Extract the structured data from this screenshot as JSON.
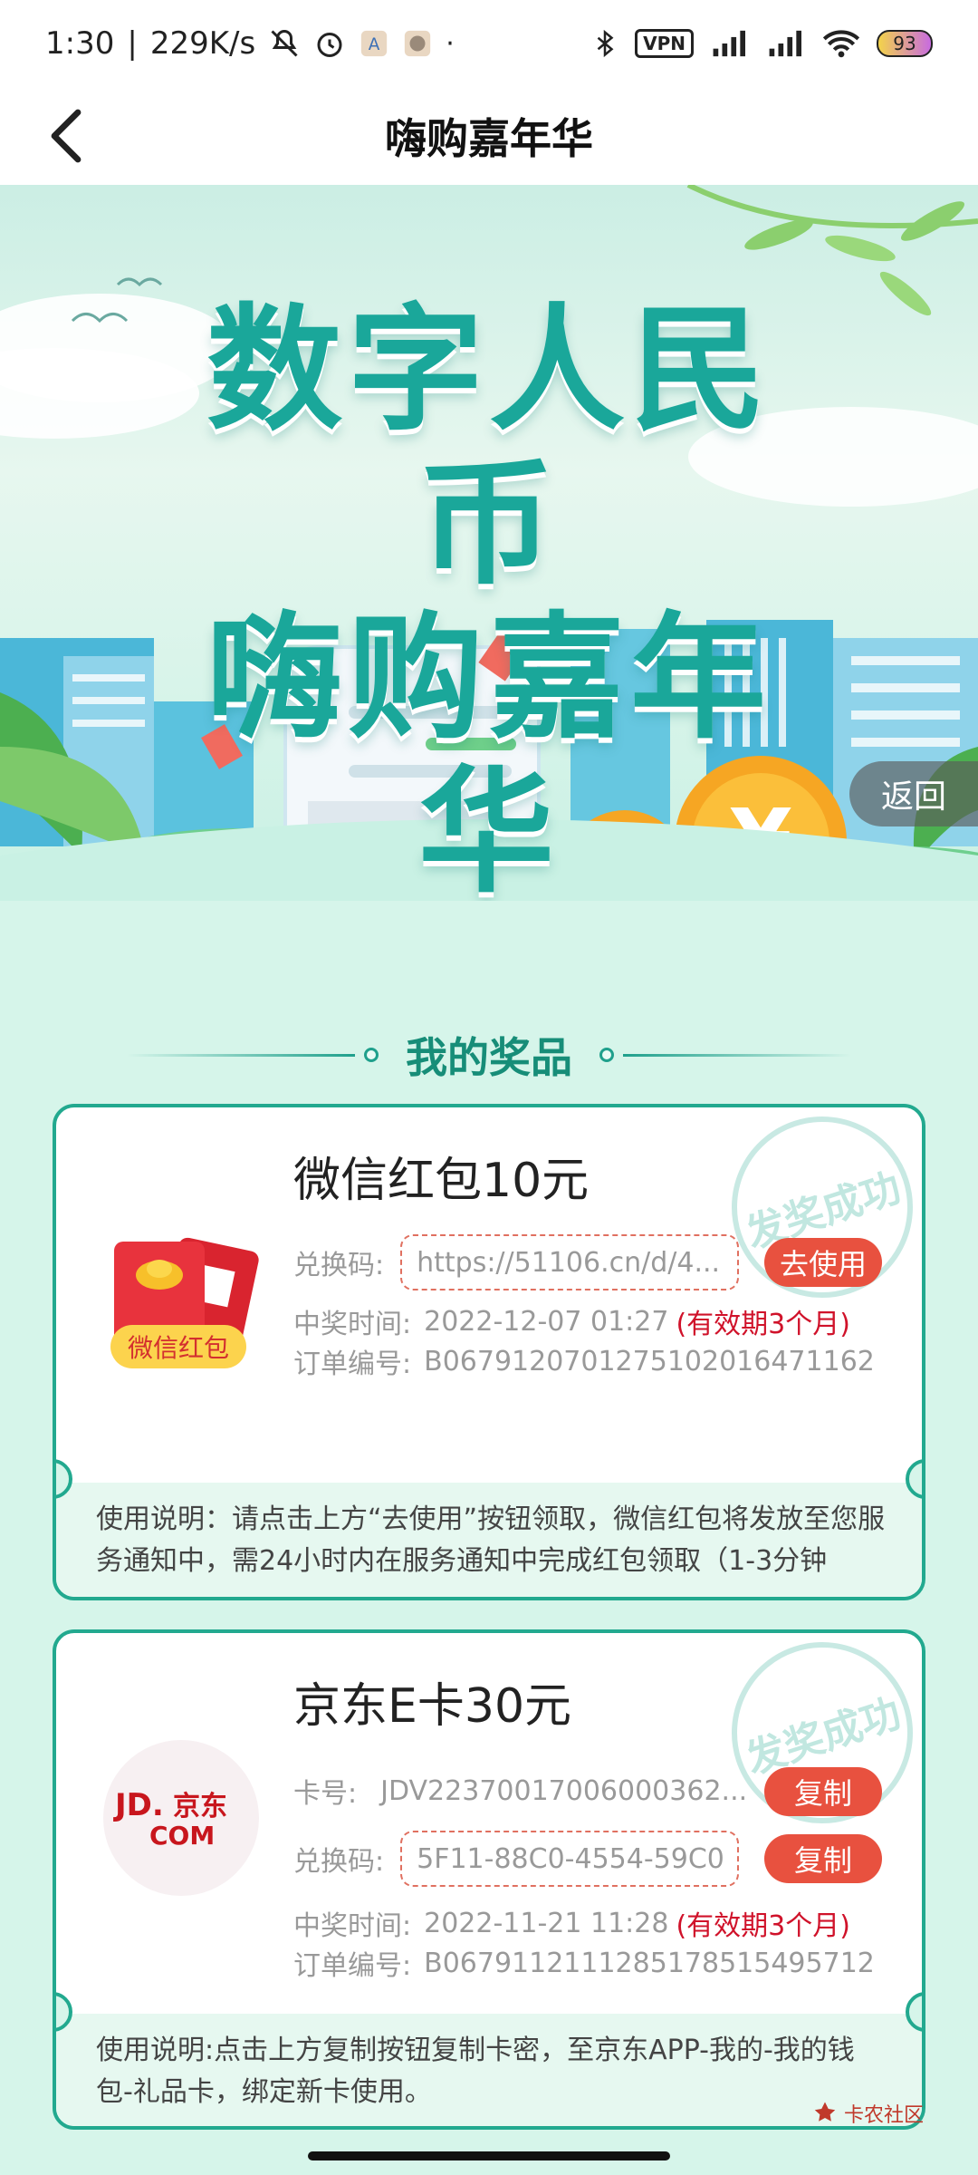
{
  "status_bar": {
    "time": "1:30",
    "speed": "229K/s",
    "vpn": "VPN",
    "battery": "93"
  },
  "header": {
    "title": "嗨购嘉年华"
  },
  "banner": {
    "title_line1": "数字人民币",
    "title_line2": "嗨购嘉年华",
    "return_label": "返回"
  },
  "section": {
    "heading": "我的奖品"
  },
  "cards": [
    {
      "name": "微信红包10元",
      "icon_label": "微信红包",
      "stamp": "发奖成功",
      "code_label": "兑换码:",
      "code_value": "https://51106.cn/d/4...",
      "use_button": "去使用",
      "time_label": "中奖时间:",
      "time_value": "2022-12-07 01:27",
      "validity": "(有效期3个月)",
      "order_label": "订单编号:",
      "order_value": "B067912070127510201647116​2",
      "note": "使用说明：请点击上方“去使用”按钮领取，微信红包将发放至您服务通知中，需24小时内在服务通知中完成红包领取（1-3分钟"
    },
    {
      "name": "京东E卡30元",
      "icon_label": "JD.京东 .COM",
      "stamp": "发奖成功",
      "card_label": "卡号:",
      "card_value": "JDV22370017006000362...",
      "copy_button_1": "复制",
      "code_label": "兑换码:",
      "code_value": "5F11-88C0-4554-59C0",
      "copy_button_2": "复制",
      "time_label": "中奖时间:",
      "time_value": "2022-11-21 11:28",
      "validity": "(有效期3个月)",
      "order_label": "订单编号:",
      "order_value": "B067911211128517851549571​2",
      "note": "使用说明:点击上方复制按钮复制卡密，至京东APP-我的-我的钱包-礼品卡，绑定新卡使用。"
    }
  ],
  "watermark": "卡农社区"
}
